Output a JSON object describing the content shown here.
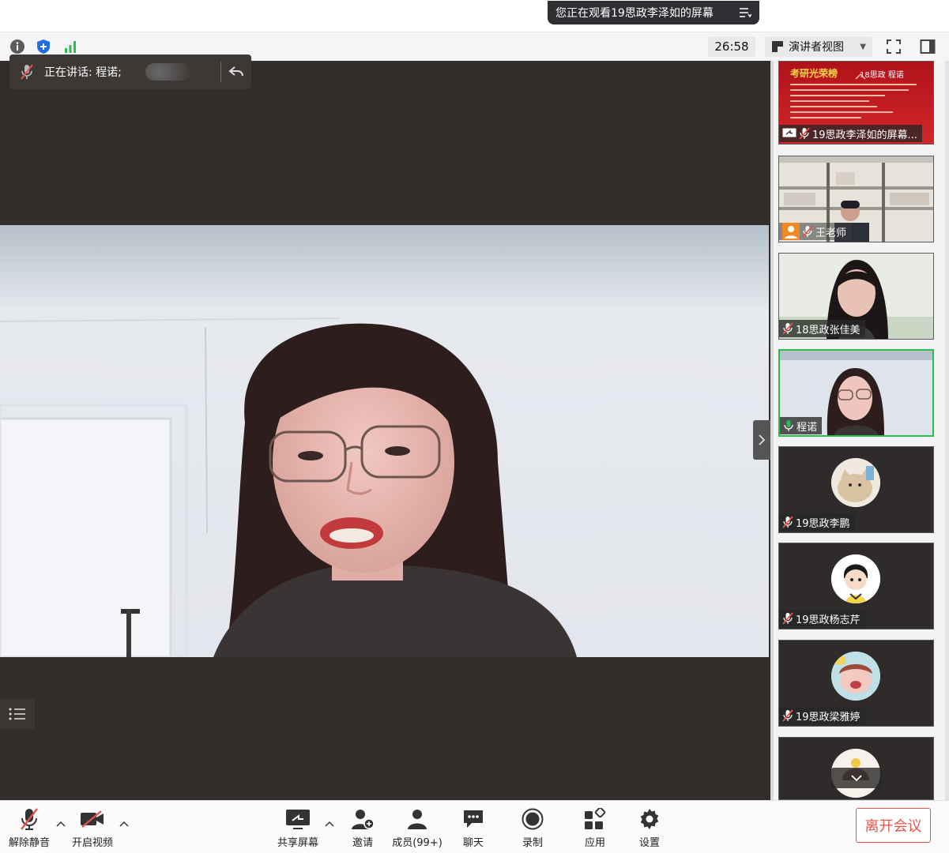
{
  "banner": {
    "text": "您正在观看19思政李泽如的屏幕"
  },
  "toolbar": {
    "timer": "26:58",
    "view_label": "演讲者视图"
  },
  "speaker": {
    "text": "正在讲话: 程诺;"
  },
  "gallery": {
    "tiles": [
      {
        "name": "19思政李泽如的屏幕...",
        "screen_title": "考研光荣榜",
        "screen_sub": "18思政 程诺"
      },
      {
        "name": "王老师"
      },
      {
        "name": "18思政张佳美"
      },
      {
        "name": "程诺"
      },
      {
        "name": "19思政李鹏"
      },
      {
        "name": "19思政杨志芹"
      },
      {
        "name": "19思政梁雅婷"
      }
    ]
  },
  "controls": {
    "unmute": "解除静音",
    "start_video": "开启视频",
    "share_screen": "共享屏幕",
    "invite": "邀请",
    "members": "成员(99+)",
    "chat": "聊天",
    "record": "录制",
    "apps": "应用",
    "settings": "设置",
    "leave": "离开会议"
  },
  "colors": {
    "accent_green": "#2dbd4f",
    "leave_red": "#e5534b",
    "stage_bg": "#322d2b",
    "banner_bg": "#2f2f33"
  },
  "icons": [
    "info-icon",
    "shield-icon",
    "signal-icon",
    "speaker-view-icon",
    "fullscreen-icon",
    "sidebar-icon",
    "mic-muted-icon",
    "video-off-icon",
    "share-icon",
    "invite-icon",
    "members-icon",
    "chat-icon",
    "record-icon",
    "apps-icon",
    "gear-icon"
  ]
}
